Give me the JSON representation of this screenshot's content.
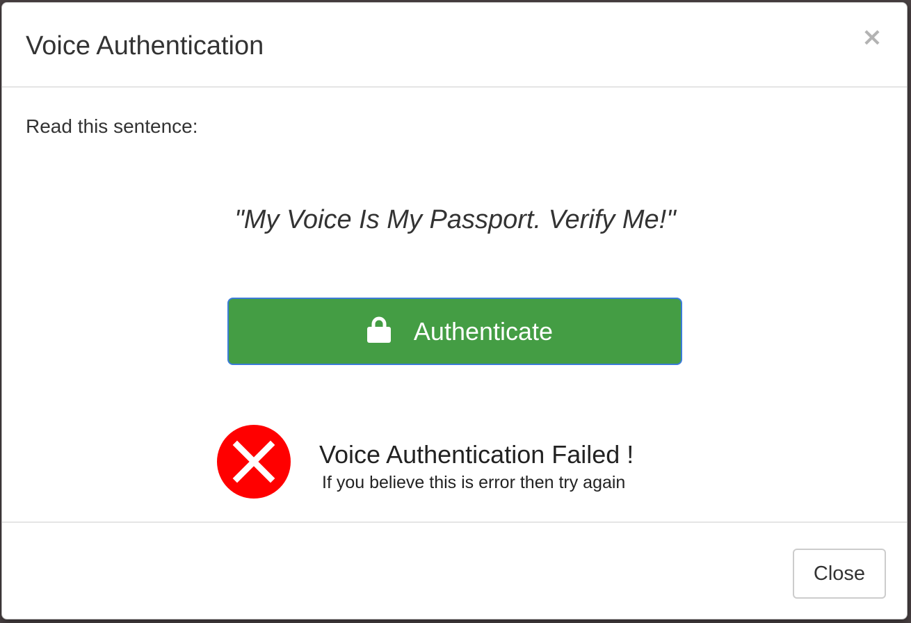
{
  "modal": {
    "title": "Voice Authentication",
    "close_icon": "close-icon",
    "close_glyph": "×"
  },
  "body": {
    "prompt_label": "Read this sentence:",
    "sentence": "\"My Voice Is My Passport. Verify Me!\"",
    "authenticate_button": {
      "label": "Authenticate",
      "icon": "lock-icon",
      "color": "#449d44"
    },
    "status": {
      "icon": "error-icon",
      "icon_color": "#ff0000",
      "title": "Voice Authentication Failed !",
      "subtitle": "If you believe this is error then try again"
    }
  },
  "footer": {
    "close_label": "Close"
  }
}
